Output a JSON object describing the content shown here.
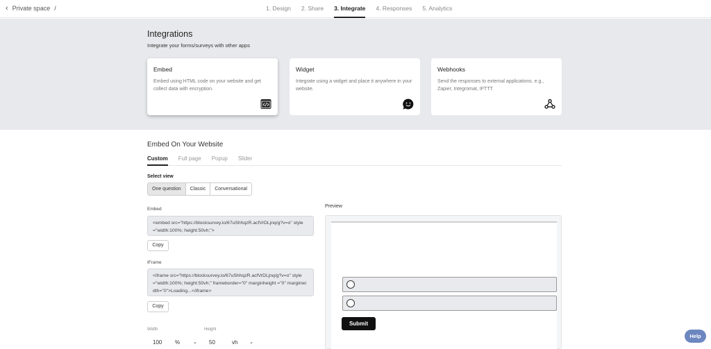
{
  "header": {
    "breadcrumb": "Private space",
    "breadcrumb_sep": "/",
    "steps": [
      "1. Design",
      "2. Share",
      "3. Integrate",
      "4. Responses",
      "5. Analytics"
    ],
    "active_step": 2
  },
  "integrations": {
    "title": "Integrations",
    "subtitle": "Integrate your forms/surveys with other apps",
    "cards": [
      {
        "title": "Embed",
        "desc": "Embed using HTML code on your website and get collect data with encryption.",
        "icon": "code-icon",
        "selected": true
      },
      {
        "title": "Widget",
        "desc": "Integrate using a widget and place it anywhere in your website.",
        "icon": "smile-icon",
        "selected": false
      },
      {
        "title": "Webhooks",
        "desc": "Send the responses to external applications. e.g., Zapier, Integromat, IFTTT.",
        "icon": "webhook-icon",
        "selected": false
      }
    ]
  },
  "embed": {
    "title": "Embed On Your Website",
    "tabs": [
      "Custom",
      "Full page",
      "Popup",
      "Slider"
    ],
    "active_tab": 0,
    "select_view_label": "Select view",
    "views": [
      "One question",
      "Classic",
      "Conversational"
    ],
    "active_view": 0,
    "embed_label": "Embed",
    "embed_code": "<embed src=\"https://blocksurvey.io/67uShhqzR.acfVrDLjnq/g?v=o\" style=\"width:100%; height:50vh;\">",
    "iframe_label": "IFrame",
    "iframe_code": "<iframe src=\"https://blocksurvey.io/67uShhqzR.acfVrDLjnq/g?v=o\" style=\"width:100%; height:50vh;\" frameborder=\"0\" marginheight =\"0\" marginwidth=\"0\">Loading...</iframe>",
    "copy_label": "Copy",
    "width_label": "Width",
    "width_value": "100",
    "width_unit": "%",
    "height_label": "Height",
    "height_value": "50",
    "height_unit": "vh"
  },
  "preview": {
    "label": "Preview",
    "submit_label": "Submit"
  },
  "help_label": "Help"
}
